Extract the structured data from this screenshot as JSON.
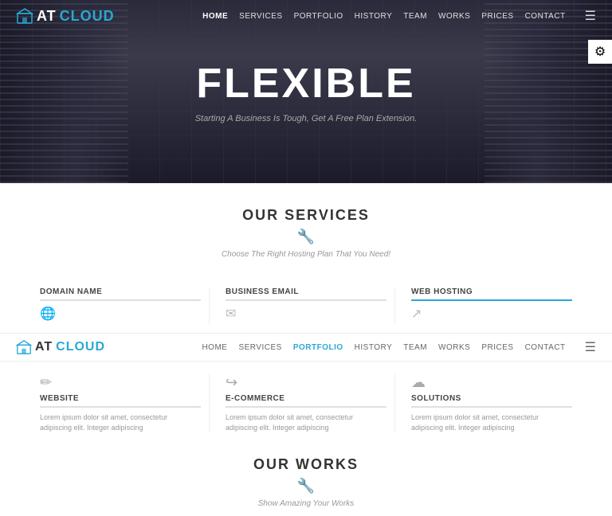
{
  "brand": {
    "logo_icon": "🏠",
    "text_at": "AT",
    "text_cloud": " CLOUD"
  },
  "navbar": {
    "links": [
      {
        "label": "HOME",
        "active": true
      },
      {
        "label": "SERVICES",
        "active": false
      },
      {
        "label": "PORTFOLIO",
        "active": false
      },
      {
        "label": "HISTORY",
        "active": false
      },
      {
        "label": "TEAM",
        "active": false
      },
      {
        "label": "WORKS",
        "active": false
      },
      {
        "label": "PRICES",
        "active": false
      },
      {
        "label": "CONTACT",
        "active": false
      }
    ]
  },
  "navbar2": {
    "links": [
      {
        "label": "HOME",
        "active": false
      },
      {
        "label": "SERVICES",
        "active": false
      },
      {
        "label": "PORTFOLIO",
        "active": true
      },
      {
        "label": "HISTORY",
        "active": false
      },
      {
        "label": "TEAM",
        "active": false
      },
      {
        "label": "WORKS",
        "active": false
      },
      {
        "label": "PRICES",
        "active": false
      },
      {
        "label": "CONTACT",
        "active": false
      }
    ]
  },
  "hero": {
    "title": "FLEXIBLE",
    "subtitle": "Starting A Business Is Tough, Get A Free Plan Extension."
  },
  "settings_icon": "⚙",
  "services_section": {
    "title": "OUR SERVICES",
    "icon": "🔧",
    "subtitle": "Choose The Right Hosting Plan That You Need!"
  },
  "service_cards": [
    {
      "title": "DOMAIN NAME",
      "icon": "🌐",
      "text": ""
    },
    {
      "title": "BUSINESS EMAIL",
      "icon": "✉",
      "text": ""
    },
    {
      "title": "WEB HOSTING",
      "icon": "↗",
      "text": ""
    }
  ],
  "service_cards2": [
    {
      "title": "WEBSITE",
      "icon": "✏",
      "text": "Lorem ipsum dolor sit amet, consectetur adipiscing elit. Integer adipiscing"
    },
    {
      "title": "E-COMMERCE",
      "icon": "↪",
      "text": "Lorem ipsum dolor sit amet, consectetur adipiscing elit. Integer adipiscing"
    },
    {
      "title": "SOLUTIONS",
      "icon": "☁",
      "text": "Lorem ipsum dolor sit amet, consectetur adipiscing elit. Integer adipiscing"
    }
  ],
  "works_section": {
    "title": "OUR WORKS",
    "icon": "🔧",
    "subtitle": "Show Amazing Your Works"
  }
}
